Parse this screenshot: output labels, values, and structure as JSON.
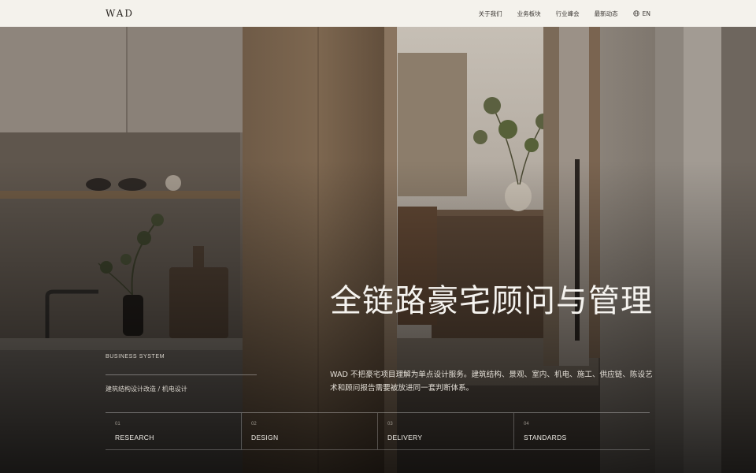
{
  "header": {
    "logo": "WAD",
    "nav": [
      "关于我们",
      "业务板块",
      "行业峰会",
      "最新动态"
    ],
    "lang_label": "EN"
  },
  "hero": {
    "headline": "全链路豪宅顾问与管理",
    "description": "WAD 不把豪宅项目理解为单点设计服务。建筑结构、景观、室内、机电、施工、供应链、陈设艺术和顾问报告需要被放进同一套判断体系。",
    "side_label": "BUSINESS SYSTEM",
    "side_text": "建筑结构设计改造 / 机电设计"
  },
  "tabs": [
    {
      "num": "01",
      "label": "RESEARCH"
    },
    {
      "num": "02",
      "label": "DESIGN"
    },
    {
      "num": "03",
      "label": "DELIVERY"
    },
    {
      "num": "04",
      "label": "STANDARDS"
    }
  ],
  "colors": {
    "header_bg": "#f4f2ec",
    "hero_text": "#f5f3ef",
    "wood": "#6e5a45"
  },
  "icons": [
    "globe-icon"
  ]
}
